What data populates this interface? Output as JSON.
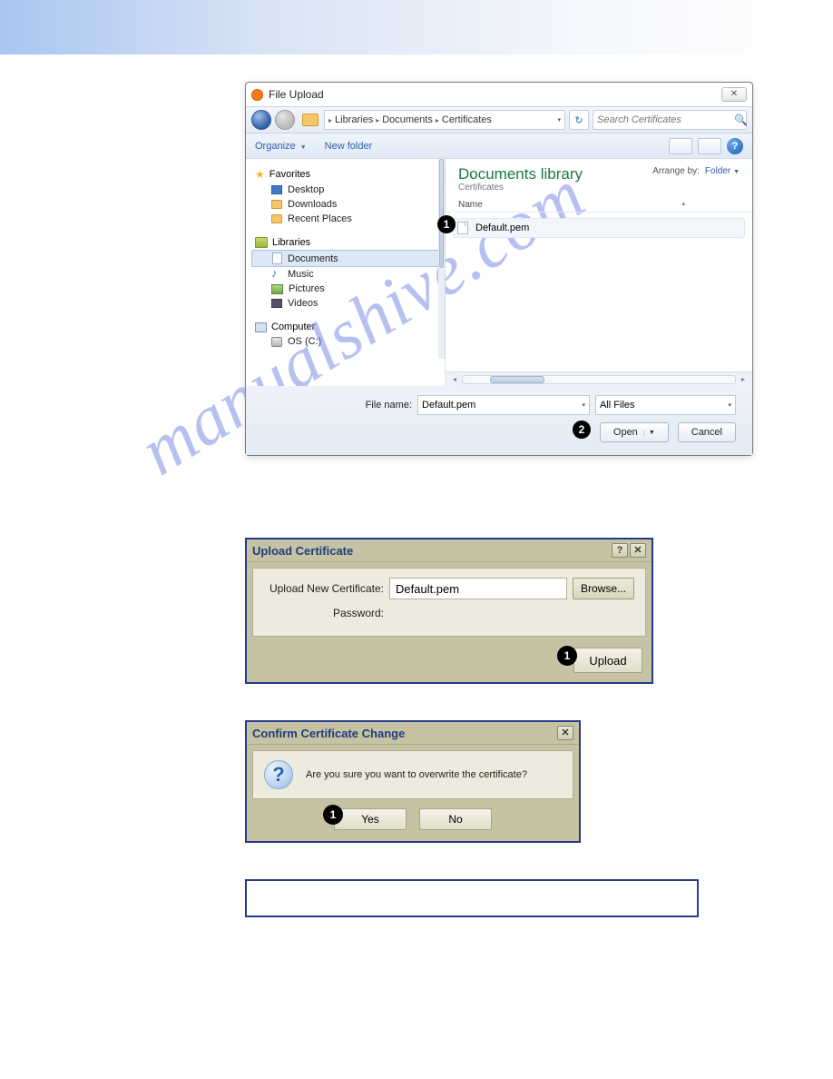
{
  "file_upload": {
    "title": "File Upload",
    "breadcrumbs": [
      "Libraries",
      "Documents",
      "Certificates"
    ],
    "search_placeholder": "Search Certificates",
    "organize": "Organize",
    "new_folder": "New folder",
    "tree": {
      "favorites": "Favorites",
      "fav_items": [
        "Desktop",
        "Downloads",
        "Recent Places"
      ],
      "libraries": "Libraries",
      "lib_items": [
        "Documents",
        "Music",
        "Pictures",
        "Videos"
      ],
      "computer": "Computer",
      "comp_items": [
        "OS (C:)"
      ]
    },
    "content": {
      "lib_title": "Documents library",
      "lib_sub": "Certificates",
      "arrange_label": "Arrange by:",
      "arrange_value": "Folder",
      "col_name": "Name",
      "file": "Default.pem",
      "callout": "1"
    },
    "bottom": {
      "filename_label": "File name:",
      "filename": "Default.pem",
      "filetype": "All Files",
      "open": "Open",
      "cancel": "Cancel",
      "callout": "2"
    }
  },
  "upload_cert": {
    "title": "Upload Certificate",
    "label_new": "Upload New Certificate:",
    "value": "Default.pem",
    "browse": "Browse...",
    "label_pw": "Password:",
    "upload": "Upload",
    "callout": "1"
  },
  "confirm": {
    "title": "Confirm Certificate Change",
    "msg": "Are you sure you want to overwrite the certificate?",
    "yes": "Yes",
    "no": "No",
    "callout": "1"
  },
  "watermark": "manualshive.com"
}
